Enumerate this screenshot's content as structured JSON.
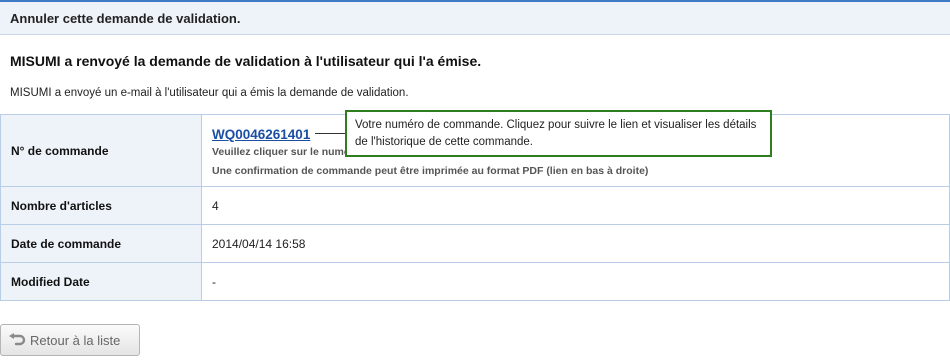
{
  "header": {
    "title": "Annuler cette demande de validation."
  },
  "main": {
    "heading": "MISUMI a renvoyé la demande de validation à l'utilisateur qui l'a émise.",
    "info": "MISUMI a envoyé un e-mail à l'utilisateur qui a émis la demande de validation."
  },
  "details": {
    "order_number": {
      "label": "N° de commande",
      "value": "WQ0046261401",
      "hint": "Veuillez cliquer sur le numé",
      "hint2": "Une confirmation de commande peut être imprimée au format PDF (lien en bas à droite)"
    },
    "items": {
      "label": "Nombre d'articles",
      "value": "4"
    },
    "order_date": {
      "label": "Date de commande",
      "value": "2014/04/14 16:58"
    },
    "modified_date": {
      "label": "Modified Date",
      "value": "-"
    }
  },
  "tooltip": {
    "text": "Votre numéro de commande. Cliquez pour suivre le lien et visualiser les détails de l'historique de cette commande."
  },
  "back_button": {
    "label": "Retour à la liste",
    "icon": "return-arrow-icon"
  },
  "colors": {
    "accent": "#3f7bc8",
    "link": "#1a4fa3",
    "tooltip_border": "#2e7d1f",
    "label_bg": "#eef3fa",
    "table_border": "#b9cde6"
  }
}
